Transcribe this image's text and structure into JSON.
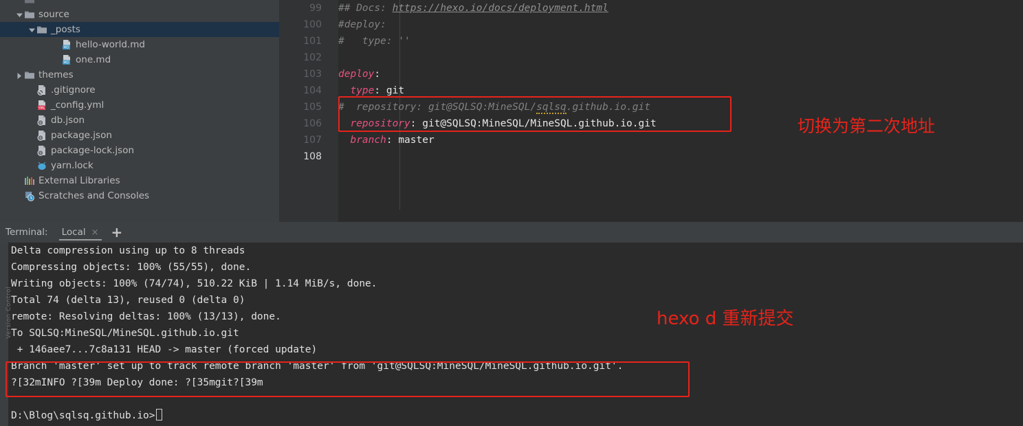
{
  "project_tree": {
    "items": [
      {
        "label": "",
        "icon": "folder-icon",
        "indent": 22,
        "arrow": "none",
        "selected": false,
        "partial": true
      },
      {
        "label": "source",
        "icon": "folder-icon",
        "indent": 22,
        "arrow": "expanded",
        "selected": false
      },
      {
        "label": "_posts",
        "icon": "folder-icon",
        "indent": 40,
        "arrow": "expanded",
        "selected": true
      },
      {
        "label": "hello-world.md",
        "icon": "markdown-file-icon",
        "indent": 76,
        "arrow": "none",
        "selected": false
      },
      {
        "label": "one.md",
        "icon": "markdown-file-icon",
        "indent": 76,
        "arrow": "none",
        "selected": false
      },
      {
        "label": "themes",
        "icon": "folder-icon",
        "indent": 22,
        "arrow": "collapsed",
        "selected": false
      },
      {
        "label": ".gitignore",
        "icon": "gitignore-file-icon",
        "indent": 40,
        "arrow": "none",
        "selected": false
      },
      {
        "label": "_config.yml",
        "icon": "yml-file-icon",
        "indent": 40,
        "arrow": "none",
        "selected": false
      },
      {
        "label": "db.json",
        "icon": "json-file-icon",
        "indent": 40,
        "arrow": "none",
        "selected": false
      },
      {
        "label": "package.json",
        "icon": "json-file-icon",
        "indent": 40,
        "arrow": "none",
        "selected": false
      },
      {
        "label": "package-lock.json",
        "icon": "json-file-icon",
        "indent": 40,
        "arrow": "none",
        "selected": false
      },
      {
        "label": "yarn.lock",
        "icon": "yarn-file-icon",
        "indent": 40,
        "arrow": "none",
        "selected": false
      },
      {
        "label": "External Libraries",
        "icon": "external-libraries-icon",
        "indent": 22,
        "arrow": "none",
        "selected": false
      },
      {
        "label": "Scratches and Consoles",
        "icon": "scratches-icon",
        "indent": 22,
        "arrow": "none",
        "selected": false
      }
    ]
  },
  "editor": {
    "first_line_number": 99,
    "current_line_number": 108,
    "line_numbers": [
      "99",
      "100",
      "101",
      "102",
      "103",
      "104",
      "105",
      "106",
      "107",
      "108"
    ],
    "lines": [
      {
        "num": "99",
        "segments": [
          {
            "text": "## Docs: ",
            "style": "comment"
          },
          {
            "text": "https://hexo.io/docs/deployment.html",
            "style": "link"
          }
        ]
      },
      {
        "num": "100",
        "segments": [
          {
            "text": "#deploy:",
            "style": "comment"
          }
        ]
      },
      {
        "num": "101",
        "segments": [
          {
            "text": "#   type: ''",
            "style": "comment"
          }
        ]
      },
      {
        "num": "102",
        "segments": []
      },
      {
        "num": "103",
        "segments": [
          {
            "text": "deploy",
            "style": "yamlkey"
          },
          {
            "text": ":",
            "style": "val"
          }
        ]
      },
      {
        "num": "104",
        "segments": [
          {
            "text": "  type",
            "style": "yamlkey"
          },
          {
            "text": ": ",
            "style": "val"
          },
          {
            "text": "git",
            "style": "val"
          }
        ]
      },
      {
        "num": "105",
        "segments": [
          {
            "text": "#  repository: git@SQLSQ:MineSQL/",
            "style": "comment"
          },
          {
            "text": "sqlsq",
            "style": "typo"
          },
          {
            "text": ".github.io.git",
            "style": "comment"
          }
        ]
      },
      {
        "num": "106",
        "segments": [
          {
            "text": "  repository",
            "style": "yamlkey"
          },
          {
            "text": ": ",
            "style": "val"
          },
          {
            "text": "git@SQLSQ:MineSQL/MineSQL.github.io.git",
            "style": "val"
          }
        ]
      },
      {
        "num": "107",
        "segments": [
          {
            "text": "  branch",
            "style": "yamlkey"
          },
          {
            "text": ": ",
            "style": "val"
          },
          {
            "text": "master",
            "style": "val"
          }
        ]
      },
      {
        "num": "108",
        "segments": []
      }
    ]
  },
  "annotations": {
    "editor_note": "切换为第二次地址",
    "terminal_note": "hexo d 重新提交",
    "color": "#e8231a"
  },
  "terminal": {
    "panel_label": "Terminal:",
    "tab_label": "Local",
    "tab_close": "×",
    "add_tab": "+",
    "sidebar_vertical_text": "Version Control",
    "lines": [
      "Delta compression using up to 8 threads",
      "Compressing objects: 100% (55/55), done.",
      "Writing objects: 100% (74/74), 510.22 KiB | 1.14 MiB/s, done.",
      "Total 74 (delta 13), reused 0 (delta 0)",
      "remote: Resolving deltas: 100% (13/13), done.",
      "To SQLSQ:MineSQL/MineSQL.github.io.git",
      " + 146aee7...7c8a131 HEAD -> master (forced update)",
      "Branch 'master' set up to track remote branch 'master' from 'git@SQLSQ:MineSQL/MineSQL.github.io.git'.",
      "?[32mINFO ?[39m Deploy done: ?[35mgit?[39m",
      "",
      "D:\\Blog\\sqlsq.github.io>"
    ],
    "prompt": "D:\\Blog\\sqlsq.github.io>"
  }
}
